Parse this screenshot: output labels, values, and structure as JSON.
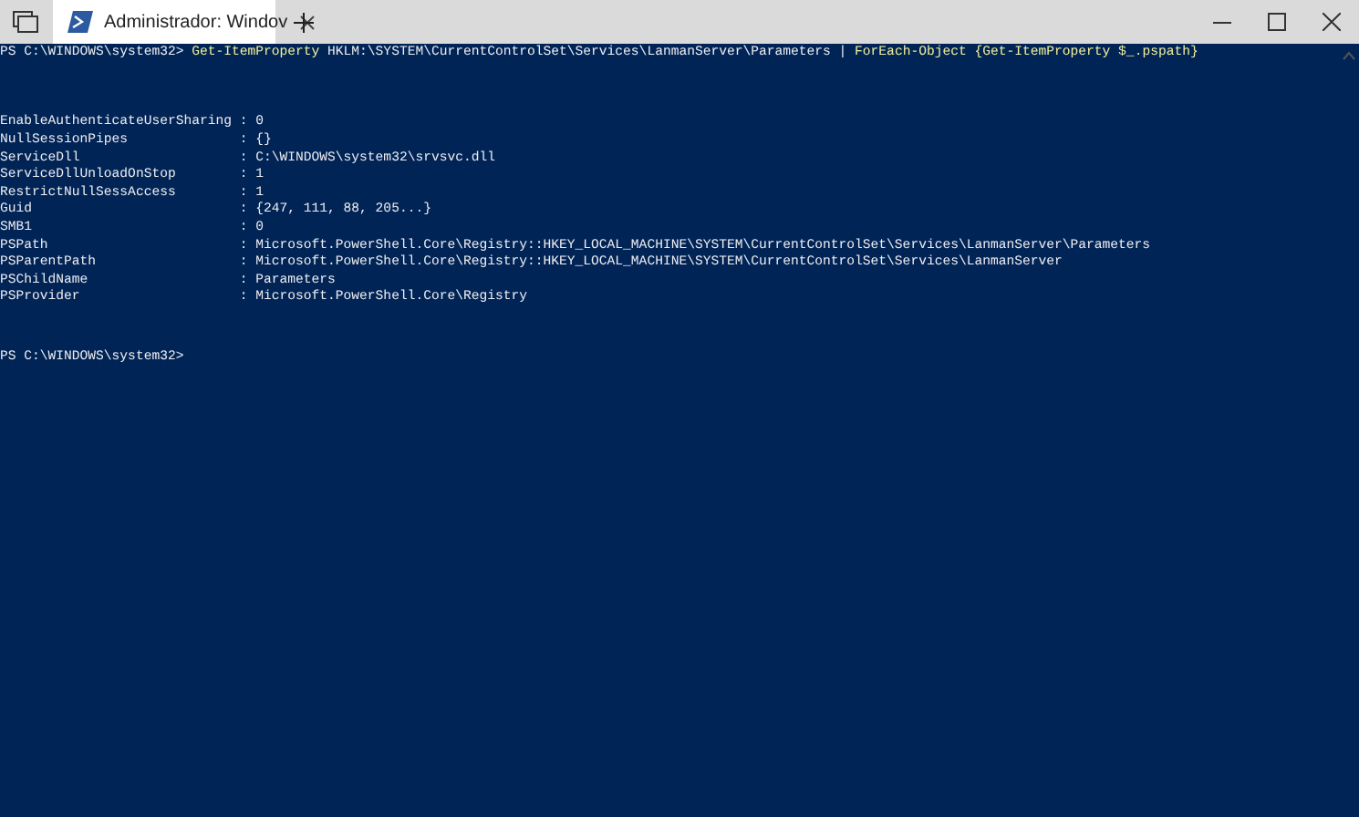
{
  "window": {
    "tab": {
      "title": "Administrador: Windov",
      "selected": true
    }
  },
  "console": {
    "command_line": [
      {
        "text": "PS C:\\WINDOWS\\system32> ",
        "kind": "prompt"
      },
      {
        "text": "Get-ItemProperty",
        "kind": "command"
      },
      {
        "text": " HKLM:\\SYSTEM\\CurrentControlSet\\Services\\LanmanServer\\Parameters | ",
        "kind": "argument"
      },
      {
        "text": "ForEach-Object",
        "kind": "command"
      },
      {
        "text": " {Get-ItemProperty $_.pspath}",
        "kind": "command"
      }
    ],
    "properties": [
      {
        "name": "EnableAuthenticateUserSharing",
        "separator": ":",
        "value": "0"
      },
      {
        "name": "NullSessionPipes",
        "separator": ":",
        "value": "{}"
      },
      {
        "name": "ServiceDll",
        "separator": ":",
        "value": "C:\\WINDOWS\\system32\\srvsvc.dll"
      },
      {
        "name": "ServiceDllUnloadOnStop",
        "separator": ":",
        "value": "1"
      },
      {
        "name": "RestrictNullSessAccess",
        "separator": ":",
        "value": "1"
      },
      {
        "name": "Guid",
        "separator": ":",
        "value": "{247, 111, 88, 205...}"
      },
      {
        "name": "SMB1",
        "separator": ":",
        "value": "0"
      },
      {
        "name": "PSPath",
        "separator": ":",
        "value": "Microsoft.PowerShell.Core\\Registry::HKEY_LOCAL_MACHINE\\SYSTEM\\CurrentControlSet\\Services\\LanmanServer\\Parameters"
      },
      {
        "name": "PSParentPath",
        "separator": ":",
        "value": "Microsoft.PowerShell.Core\\Registry::HKEY_LOCAL_MACHINE\\SYSTEM\\CurrentControlSet\\Services\\LanmanServer"
      },
      {
        "name": "PSChildName",
        "separator": ":",
        "value": "Parameters"
      },
      {
        "name": "PSProvider",
        "separator": ":",
        "value": "Microsoft.PowerShell.Core\\Registry"
      }
    ],
    "prompt": "PS C:\\WINDOWS\\system32>"
  }
}
